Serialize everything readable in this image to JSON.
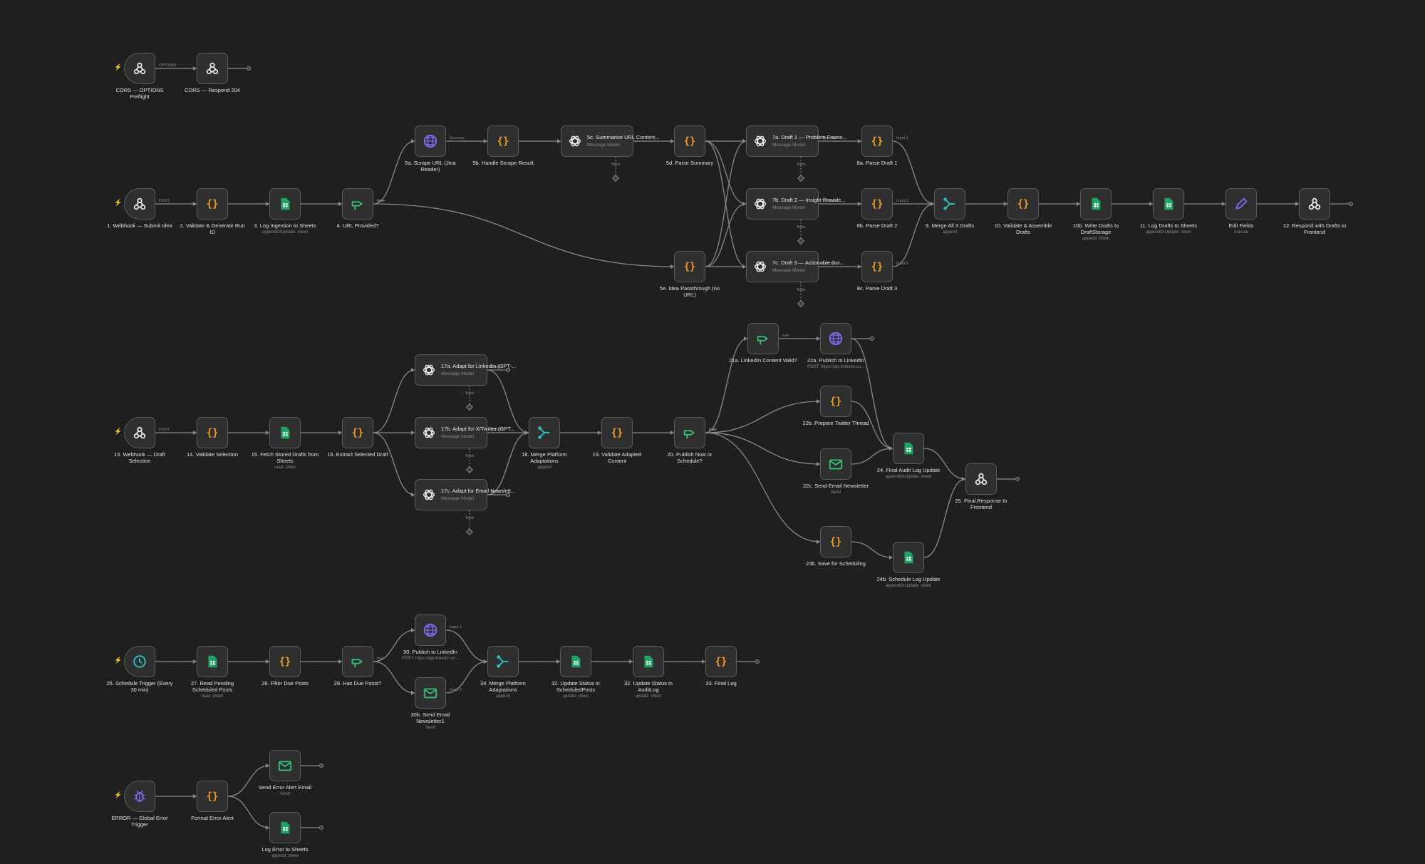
{
  "canvas": {
    "colors": {
      "background": "#1f1f1f",
      "node": "#2f2f2f",
      "node_border": "#5c5c5c",
      "wire": "#8a8a8a",
      "code_icon": "#f39c1f",
      "sheets_icon": "#1fa463",
      "ai_icon": "#e6e6e6",
      "http_icon": "#7c6cf2",
      "if_icon": "#35c27a",
      "merge_icon": "#2ec4c4",
      "trigger_bolt": "#ff6d5a"
    },
    "nodes": [
      {
        "id": "cors_opt",
        "title": "CORS — OPTIONS Preflight",
        "sub": "",
        "icon": "webhook-icon",
        "trigger": true
      },
      {
        "id": "cors_204",
        "title": "CORS — Respond 204",
        "sub": "",
        "icon": "webhook-icon"
      },
      {
        "id": "n1",
        "title": "1. Webhook — Submit Idea",
        "sub": "",
        "icon": "webhook-icon",
        "trigger": true
      },
      {
        "id": "n2",
        "title": "2. Validate & Generate Run ID",
        "sub": "",
        "icon": "code-icon"
      },
      {
        "id": "n3",
        "title": "3. Log Ingestion to Sheets",
        "sub": "appendOrUpdate: sheet",
        "icon": "sheets-icon"
      },
      {
        "id": "n4",
        "title": "4. URL Provided?",
        "sub": "",
        "icon": "if-icon"
      },
      {
        "id": "n5a",
        "title": "5a. Scrape URL (Jina Reader)",
        "sub": "",
        "icon": "globe-icon"
      },
      {
        "id": "n5b",
        "title": "5b. Handle Scrape Result",
        "sub": "",
        "icon": "code-icon"
      },
      {
        "id": "n5c",
        "title": "5c. Summarise URL Content...",
        "sub": "Message Model",
        "icon": "openai-icon",
        "wide": true,
        "label": "5c. Summarise URL Content..."
      },
      {
        "id": "n5d",
        "title": "5d. Parse Summary",
        "sub": "",
        "icon": "code-icon"
      },
      {
        "id": "n5e",
        "title": "5e. Idea Passthrough (no URL)",
        "sub": "",
        "icon": "code-icon"
      },
      {
        "id": "n7a",
        "title": "7a. Draft 1 — Problem Frame...",
        "sub": "Message Model",
        "icon": "openai-icon",
        "wide": true
      },
      {
        "id": "n7b",
        "title": "7b. Draft 2 — Insight Provide...",
        "sub": "Message Model",
        "icon": "openai-icon",
        "wide": true
      },
      {
        "id": "n7c",
        "title": "7c. Draft 3 — Actionable Gui...",
        "sub": "Message Model",
        "icon": "openai-icon",
        "wide": true
      },
      {
        "id": "n8a",
        "title": "8a. Parse Draft 1",
        "sub": "",
        "icon": "code-icon"
      },
      {
        "id": "n8b",
        "title": "8b. Parse Draft 2",
        "sub": "",
        "icon": "code-icon"
      },
      {
        "id": "n8c",
        "title": "8c. Parse Draft 3",
        "sub": "",
        "icon": "code-icon"
      },
      {
        "id": "n9",
        "title": "9. Merge All 3 Drafts",
        "sub": "append",
        "icon": "merge-icon"
      },
      {
        "id": "n10",
        "title": "10. Validate & Assemble Drafts",
        "sub": "",
        "icon": "code-icon"
      },
      {
        "id": "n10b",
        "title": "10b. Write Drafts to DraftStorage",
        "sub": "append: sheet",
        "icon": "sheets-icon"
      },
      {
        "id": "n11",
        "title": "11. Log Drafts to Sheets",
        "sub": "appendOrUpdate: sheet",
        "icon": "sheets-icon"
      },
      {
        "id": "nedit",
        "title": "Edit Fields",
        "sub": "manual",
        "icon": "pencil-icon"
      },
      {
        "id": "n12",
        "title": "12. Respond with Drafts to Frontend",
        "sub": "",
        "icon": "webhook-icon"
      },
      {
        "id": "n13",
        "title": "13. Webhook — Draft Selection",
        "sub": "",
        "icon": "webhook-icon",
        "trigger": true
      },
      {
        "id": "n14",
        "title": "14. Validate Selection",
        "sub": "",
        "icon": "code-icon"
      },
      {
        "id": "n15",
        "title": "15. Fetch Stored Drafts from Sheets",
        "sub": "read: sheet",
        "icon": "sheets-icon"
      },
      {
        "id": "n16",
        "title": "16. Extract Selected Draft",
        "sub": "",
        "icon": "code-icon"
      },
      {
        "id": "n17a",
        "title": "17a. Adapt for LinkedIn (GPT-...",
        "sub": "Message Model",
        "icon": "openai-icon",
        "wide": true
      },
      {
        "id": "n17b",
        "title": "17b. Adapt for X/Twitter (GPT...",
        "sub": "Message Model",
        "icon": "openai-icon",
        "wide": true
      },
      {
        "id": "n17c",
        "title": "17c. Adapt for Email Newslett...",
        "sub": "Message Model",
        "icon": "openai-icon",
        "wide": true
      },
      {
        "id": "n18",
        "title": "18. Merge Platform Adaptations",
        "sub": "append",
        "icon": "merge-icon"
      },
      {
        "id": "n19",
        "title": "19. Validate Adapted Content",
        "sub": "",
        "icon": "code-icon"
      },
      {
        "id": "n20",
        "title": "20. Publish Now or Schedule?",
        "sub": "",
        "icon": "if-icon"
      },
      {
        "id": "n21a",
        "title": "21a. LinkedIn Content Valid?",
        "sub": "",
        "icon": "if-icon"
      },
      {
        "id": "n22a",
        "title": "22a. Publish to LinkedIn",
        "sub": "POST: https://api.linkedin.co...",
        "icon": "globe-icon"
      },
      {
        "id": "n22b",
        "title": "22b. Prepare Twitter Thread",
        "sub": "",
        "icon": "code-icon"
      },
      {
        "id": "n22c",
        "title": "22c. Send Email Newsletter",
        "sub": "Send",
        "icon": "mail-icon"
      },
      {
        "id": "n23b",
        "title": "23b. Save for Scheduling",
        "sub": "",
        "icon": "code-icon"
      },
      {
        "id": "n24",
        "title": "24. Final Audit Log Update",
        "sub": "appendOrUpdate: sheet",
        "icon": "sheets-icon"
      },
      {
        "id": "n24b",
        "title": "24b. Schedule Log Update",
        "sub": "appendOrUpdate: sheet",
        "icon": "sheets-icon"
      },
      {
        "id": "n25",
        "title": "25. Final Response to Frontend",
        "sub": "",
        "icon": "webhook-icon"
      },
      {
        "id": "n26",
        "title": "26. Schedule Trigger (Every 30 min)",
        "sub": "",
        "icon": "clock-icon",
        "trigger": true
      },
      {
        "id": "n27",
        "title": "27. Read Pending Scheduled Posts",
        "sub": "read: sheet",
        "icon": "sheets-icon"
      },
      {
        "id": "n28",
        "title": "28. Filter Due Posts",
        "sub": "",
        "icon": "code-icon"
      },
      {
        "id": "n29",
        "title": "29. Has Due Posts?",
        "sub": "",
        "icon": "if-icon"
      },
      {
        "id": "n30",
        "title": "30. Publish to LinkedIn",
        "sub": "POST: https://api.linkedin.co...",
        "icon": "globe-icon"
      },
      {
        "id": "n30b",
        "title": "30b. Send Email Newsletter1",
        "sub": "Send",
        "icon": "mail-icon"
      },
      {
        "id": "n34",
        "title": "34. Merge Platform Adaptations",
        "sub": "append",
        "icon": "merge-icon"
      },
      {
        "id": "n32a",
        "title": "32. Update Status in ScheduledPosts",
        "sub": "update: sheet",
        "icon": "sheets-icon"
      },
      {
        "id": "n32b",
        "title": "32. Update Status in AuditLog",
        "sub": "update: sheet",
        "icon": "sheets-icon"
      },
      {
        "id": "n33",
        "title": "33. Final Log",
        "sub": "",
        "icon": "code-icon"
      },
      {
        "id": "nerr",
        "title": "ERROR — Global Error Trigger",
        "sub": "",
        "icon": "bug-icon",
        "trigger": true
      },
      {
        "id": "nfmt",
        "title": "Format Error Alert",
        "sub": "",
        "icon": "code-icon"
      },
      {
        "id": "nmail",
        "title": "Send Error Alert Email",
        "sub": "Send",
        "icon": "mail-icon"
      },
      {
        "id": "nlog",
        "title": "Log Error to Sheets",
        "sub": "append: sheet",
        "icon": "sheets-icon"
      }
    ],
    "edge_labels": {
      "options": "OPTIONS",
      "post": "POST",
      "true": "true",
      "false": "false",
      "success": "Success",
      "error": "Error",
      "tools": "Tools",
      "input1": "Input 1",
      "input2": "Input 2",
      "input3": "Input 3"
    }
  }
}
